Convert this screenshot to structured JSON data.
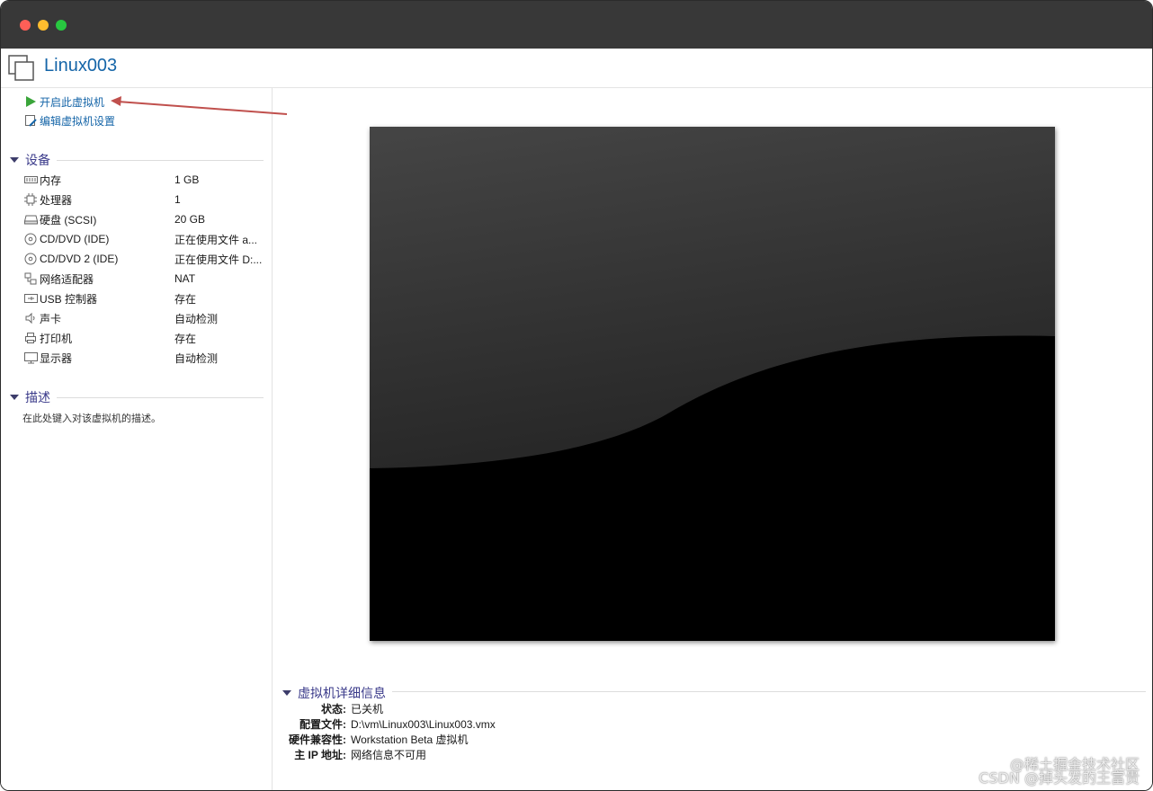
{
  "window": {
    "title": "Linux003"
  },
  "actions": {
    "power_on": "开启此虚拟机",
    "edit_settings": "编辑虚拟机设置"
  },
  "devices": {
    "section_label": "设备",
    "items": [
      {
        "name": "内存",
        "value": "1 GB",
        "icon": "memory-icon"
      },
      {
        "name": "处理器",
        "value": "1",
        "icon": "cpu-icon"
      },
      {
        "name": "硬盘 (SCSI)",
        "value": "20 GB",
        "icon": "harddisk-icon"
      },
      {
        "name": "CD/DVD (IDE)",
        "value": "正在使用文件 a...",
        "icon": "cd-icon"
      },
      {
        "name": "CD/DVD 2 (IDE)",
        "value": "正在使用文件 D:...",
        "icon": "cd-icon"
      },
      {
        "name": "网络适配器",
        "value": "NAT",
        "icon": "network-icon"
      },
      {
        "name": "USB 控制器",
        "value": "存在",
        "icon": "usb-icon"
      },
      {
        "name": "声卡",
        "value": "自动检测",
        "icon": "speaker-icon"
      },
      {
        "name": "打印机",
        "value": "存在",
        "icon": "printer-icon"
      },
      {
        "name": "显示器",
        "value": "自动检测",
        "icon": "monitor-icon"
      }
    ]
  },
  "description": {
    "section_label": "描述",
    "placeholder": "在此处键入对该虚拟机的描述。"
  },
  "details": {
    "section_label": "虚拟机详细信息",
    "rows": [
      {
        "key": "状态:",
        "value": "已关机"
      },
      {
        "key": "配置文件:",
        "value": "D:\\vm\\Linux003\\Linux003.vmx"
      },
      {
        "key": "硬件兼容性:",
        "value": "Workstation Beta 虚拟机"
      },
      {
        "key": "主 IP 地址:",
        "value": "网络信息不可用"
      }
    ]
  },
  "watermarks": {
    "line1": "@稀土掘金技术社区",
    "line2": "CSDN @掉头发的王富贵"
  },
  "colors": {
    "titlebar": "#383838",
    "link": "#1565a8",
    "section": "#3a3a8a",
    "play_green": "#3aa53a",
    "annotation_arrow": "#c0504d"
  }
}
